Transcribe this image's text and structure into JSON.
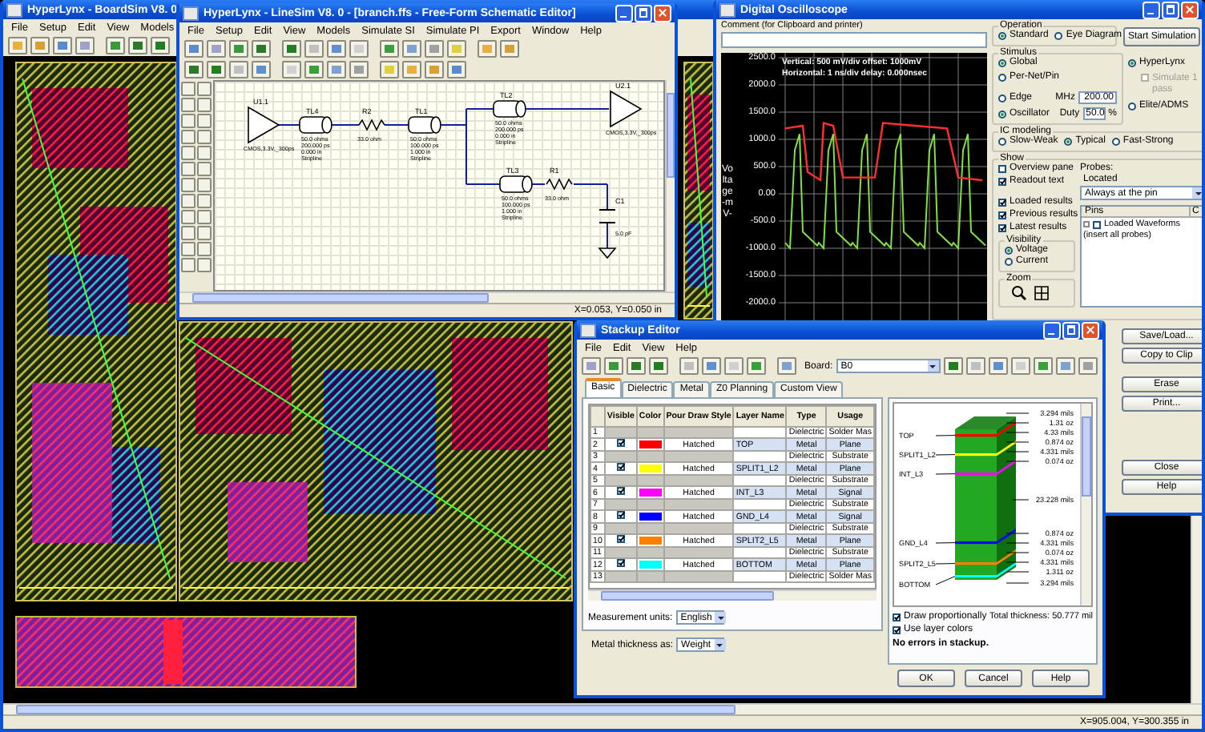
{
  "boardsim": {
    "title": "HyperLynx - BoardSim V8. 0",
    "menu": [
      "File",
      "Setup",
      "Edit",
      "View",
      "Models"
    ],
    "status": "X=905.004, Y=300.355 in"
  },
  "linesim": {
    "title": "HyperLynx - LineSim V8. 0 - [branch.ffs - Free-Form Schematic Editor]",
    "menu": [
      "File",
      "Setup",
      "Edit",
      "View",
      "Models",
      "Simulate SI",
      "Simulate PI",
      "Export",
      "Window",
      "Help"
    ],
    "parts": [
      {
        "kind": "driver",
        "label": "U1.1",
        "value": [
          "CMOS,3.3V,_300ps"
        ]
      },
      {
        "kind": "tline",
        "label": "TL4",
        "value": [
          "50.0 ohms",
          "200.000 ps",
          "0.000 in",
          "Stripline"
        ]
      },
      {
        "kind": "resistor",
        "label": "R2",
        "value": [
          "33.0 ohm"
        ]
      },
      {
        "kind": "tline",
        "label": "TL1",
        "value": [
          "50.0 ohms",
          "100.000 ps",
          "1.000 in",
          "Stripline"
        ]
      },
      {
        "kind": "tline",
        "label": "TL2",
        "value": [
          "50.0 ohms",
          "200.000 ps",
          "0.000 in",
          "Stripline"
        ]
      },
      {
        "kind": "receiver",
        "label": "U2.1",
        "value": [
          "CMOS,3.3V,_300ps"
        ]
      },
      {
        "kind": "tline",
        "label": "TL3",
        "value": [
          "50.0 ohms",
          "100.000 ps",
          "1.000 in",
          "Stripline"
        ]
      },
      {
        "kind": "resistor",
        "label": "R1",
        "value": [
          "33.0 ohm"
        ]
      },
      {
        "kind": "capacitor",
        "label": "C1",
        "value": [
          "5.0 pF"
        ]
      }
    ],
    "status": "X=0.053, Y=0.050 in"
  },
  "scope": {
    "title": "Digital Oscilloscope",
    "comment_label": "Comment (for Clipboard and printer)",
    "readout": [
      "Vertical: 500 mV/div  offset: 1000mV",
      "Horizontal: 1 ns/div  delay: 0.000nsec"
    ],
    "y_axis_label": "Voltage -mV-",
    "y_ticks": [
      "2500.0",
      "2000.0",
      "1500.0",
      "1000.0",
      "500.0",
      "0.00",
      "-500.0",
      "-1000.0",
      "-1500.0",
      "-2000.0"
    ],
    "operation": {
      "label": "Operation",
      "options": [
        {
          "label": "Standard",
          "selected": true
        },
        {
          "label": "Eye Diagram",
          "selected": false
        }
      ]
    },
    "start_button": "Start Simulation",
    "stimulus": {
      "label": "Stimulus",
      "scope_options": [
        {
          "label": "Global",
          "selected": true
        },
        {
          "label": "Per-Net/Pin",
          "selected": false
        }
      ],
      "wave_options": [
        {
          "label": "Edge",
          "selected": false
        },
        {
          "label": "Oscillator",
          "selected": true
        }
      ],
      "mhz_label": "MHz",
      "mhz": "200.00",
      "duty_label": "Duty",
      "duty": "50.0",
      "duty_unit": "%"
    },
    "engine": [
      {
        "label": "HyperLynx",
        "selected": true
      },
      {
        "label": "Elite/ADMS",
        "selected": false
      }
    ],
    "simulate_pass": {
      "label": "Simulate 1 pass",
      "checked": false,
      "disabled": true
    },
    "ic_modeling": {
      "label": "IC modeling",
      "options": [
        {
          "label": "Slow-Weak",
          "selected": false
        },
        {
          "label": "Typical",
          "selected": true
        },
        {
          "label": "Fast-Strong",
          "selected": false
        }
      ]
    },
    "show": {
      "label": "Show",
      "checks": [
        {
          "label": "Overview pane",
          "checked": false
        },
        {
          "label": "Readout text",
          "checked": true
        },
        {
          "label": "Loaded results",
          "checked": true
        },
        {
          "label": "Previous results",
          "checked": true
        },
        {
          "label": "Latest results",
          "checked": true
        }
      ],
      "visibility": {
        "label": "Visibility",
        "options": [
          {
            "label": "Voltage",
            "selected": true
          },
          {
            "label": "Current",
            "selected": false
          }
        ]
      },
      "zoom_label": "Zoom",
      "probes_label": "Probes:",
      "located_label": "Located",
      "located_value": "Always at the pin",
      "list_columns": [
        "Pins",
        "C"
      ],
      "list_items": [
        {
          "label": "Loaded Waveforms",
          "checked": false
        },
        {
          "label": "(insert all probes)"
        }
      ]
    },
    "buttons": [
      "Save/Load...",
      "Copy to Clip",
      "Erase",
      "Print...",
      "Close",
      "Help"
    ]
  },
  "stackup": {
    "title": "Stackup Editor",
    "menu": [
      "File",
      "Edit",
      "View",
      "Help"
    ],
    "board_label": "Board:",
    "board_value": "B0",
    "tabs": [
      {
        "label": "Basic",
        "selected": true
      },
      {
        "label": "Dielectric",
        "selected": false
      },
      {
        "label": "Metal",
        "selected": false
      },
      {
        "label": "Z0 Planning",
        "selected": false
      },
      {
        "label": "Custom View",
        "selected": false
      }
    ],
    "columns": [
      "",
      "Visible",
      "Color",
      "Pour Draw Style",
      "Layer Name",
      "Type",
      "Usage"
    ],
    "rows": [
      {
        "num": "1",
        "kind": "dielectric",
        "type": "Dielectric",
        "usage": "Solder Mas"
      },
      {
        "num": "2",
        "kind": "metal",
        "visible": true,
        "color": "#ff0000",
        "style": "Hatched",
        "name": "TOP",
        "type": "Metal",
        "usage": "Plane"
      },
      {
        "num": "3",
        "kind": "dielectric",
        "type": "Dielectric",
        "usage": "Substrate"
      },
      {
        "num": "4",
        "kind": "metal",
        "visible": true,
        "color": "#ffff00",
        "style": "Hatched",
        "name": "SPLIT1_L2",
        "type": "Metal",
        "usage": "Plane"
      },
      {
        "num": "5",
        "kind": "dielectric",
        "type": "Dielectric",
        "usage": "Substrate"
      },
      {
        "num": "6",
        "kind": "metal",
        "visible": true,
        "color": "#ff00ff",
        "style": "Hatched",
        "name": "INT_L3",
        "type": "Metal",
        "usage": "Signal"
      },
      {
        "num": "7",
        "kind": "dielectric",
        "type": "Dielectric",
        "usage": "Substrate"
      },
      {
        "num": "8",
        "kind": "metal",
        "visible": true,
        "color": "#0000ff",
        "style": "Hatched",
        "name": "GND_L4",
        "type": "Metal",
        "usage": "Signal"
      },
      {
        "num": "9",
        "kind": "dielectric",
        "type": "Dielectric",
        "usage": "Substrate"
      },
      {
        "num": "10",
        "kind": "metal",
        "visible": true,
        "color": "#ff8000",
        "style": "Hatched",
        "name": "SPLIT2_L5",
        "type": "Metal",
        "usage": "Plane"
      },
      {
        "num": "11",
        "kind": "dielectric",
        "type": "Dielectric",
        "usage": "Substrate"
      },
      {
        "num": "12",
        "kind": "metal",
        "visible": true,
        "color": "#00ffff",
        "style": "Hatched",
        "name": "BOTTOM",
        "type": "Metal",
        "usage": "Plane"
      },
      {
        "num": "13",
        "kind": "dielectric",
        "type": "Dielectric",
        "usage": "Solder Mas"
      }
    ],
    "units_label": "Measurement units:",
    "units_value": "English",
    "thickness_label": "Metal thickness as:",
    "thickness_value": "Weight",
    "layer_labels": [
      "TOP",
      "SPLIT1_L2",
      "INT_L3",
      "GND_L4",
      "SPLIT2_L5",
      "BOTTOM"
    ],
    "thickness_labels": [
      "3.294 mils",
      "1.31 oz",
      "4.33 mils",
      "0.874 oz",
      "4.331 mils",
      "0.074 oz",
      "23.228 mils",
      "0.874 oz",
      "4.331 mils",
      "0.074 oz",
      "4.331 mils",
      "1.311 oz",
      "3.294 mils"
    ],
    "checks": [
      {
        "label": "Draw proportionally",
        "checked": true
      },
      {
        "label": "Use layer colors",
        "checked": true
      }
    ],
    "total": "Total thickness:  50.777 mil",
    "errors": "No errors in stackup.",
    "buttons": [
      "OK",
      "Cancel",
      "Help"
    ]
  }
}
